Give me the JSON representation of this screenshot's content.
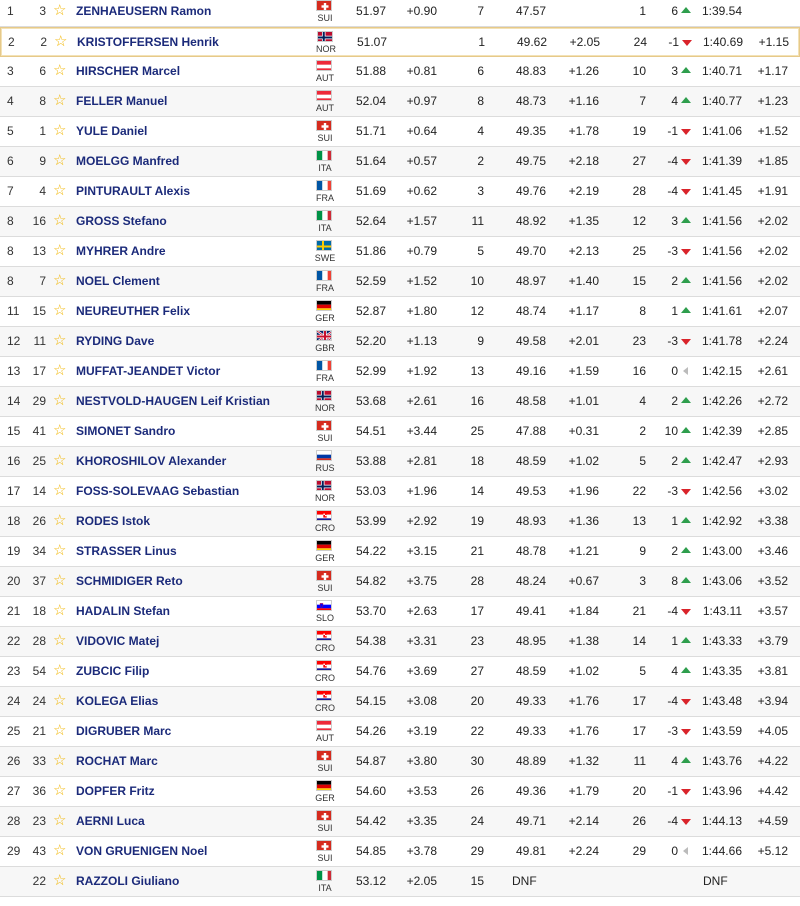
{
  "colors": {
    "name": "#1b2a7a",
    "star": "#f2b705",
    "up": "#2e9e4d",
    "down": "#d9232a",
    "highlight_border": "#e6c98a"
  },
  "icons": {
    "favorite": "star-icon",
    "up": "arrow-up-icon",
    "down": "arrow-down-icon",
    "same": "arrow-left-icon"
  },
  "rows": [
    {
      "rank": "1",
      "bib": "3",
      "name": "ZENHAEUSERN Ramon",
      "nat": "SUI",
      "r1_time": "51.97",
      "r1_diff": "+0.90",
      "r1_rank": "7",
      "r2_time": "47.57",
      "r2_diff": "",
      "r2_rank": "1",
      "change": "6",
      "dir": "up",
      "total": "1:39.54",
      "total_diff": ""
    },
    {
      "rank": "2",
      "bib": "2",
      "name": "KRISTOFFERSEN Henrik",
      "nat": "NOR",
      "r1_time": "51.07",
      "r1_diff": "",
      "r1_rank": "1",
      "r2_time": "49.62",
      "r2_diff": "+2.05",
      "r2_rank": "24",
      "change": "-1",
      "dir": "down",
      "total": "1:40.69",
      "total_diff": "+1.15",
      "highlight": true
    },
    {
      "rank": "3",
      "bib": "6",
      "name": "HIRSCHER Marcel",
      "nat": "AUT",
      "r1_time": "51.88",
      "r1_diff": "+0.81",
      "r1_rank": "6",
      "r2_time": "48.83",
      "r2_diff": "+1.26",
      "r2_rank": "10",
      "change": "3",
      "dir": "up",
      "total": "1:40.71",
      "total_diff": "+1.17"
    },
    {
      "rank": "4",
      "bib": "8",
      "name": "FELLER Manuel",
      "nat": "AUT",
      "r1_time": "52.04",
      "r1_diff": "+0.97",
      "r1_rank": "8",
      "r2_time": "48.73",
      "r2_diff": "+1.16",
      "r2_rank": "7",
      "change": "4",
      "dir": "up",
      "total": "1:40.77",
      "total_diff": "+1.23"
    },
    {
      "rank": "5",
      "bib": "1",
      "name": "YULE Daniel",
      "nat": "SUI",
      "r1_time": "51.71",
      "r1_diff": "+0.64",
      "r1_rank": "4",
      "r2_time": "49.35",
      "r2_diff": "+1.78",
      "r2_rank": "19",
      "change": "-1",
      "dir": "down",
      "total": "1:41.06",
      "total_diff": "+1.52"
    },
    {
      "rank": "6",
      "bib": "9",
      "name": "MOELGG Manfred",
      "nat": "ITA",
      "r1_time": "51.64",
      "r1_diff": "+0.57",
      "r1_rank": "2",
      "r2_time": "49.75",
      "r2_diff": "+2.18",
      "r2_rank": "27",
      "change": "-4",
      "dir": "down",
      "total": "1:41.39",
      "total_diff": "+1.85"
    },
    {
      "rank": "7",
      "bib": "4",
      "name": "PINTURAULT Alexis",
      "nat": "FRA",
      "r1_time": "51.69",
      "r1_diff": "+0.62",
      "r1_rank": "3",
      "r2_time": "49.76",
      "r2_diff": "+2.19",
      "r2_rank": "28",
      "change": "-4",
      "dir": "down",
      "total": "1:41.45",
      "total_diff": "+1.91"
    },
    {
      "rank": "8",
      "bib": "16",
      "name": "GROSS Stefano",
      "nat": "ITA",
      "r1_time": "52.64",
      "r1_diff": "+1.57",
      "r1_rank": "11",
      "r2_time": "48.92",
      "r2_diff": "+1.35",
      "r2_rank": "12",
      "change": "3",
      "dir": "up",
      "total": "1:41.56",
      "total_diff": "+2.02"
    },
    {
      "rank": "8",
      "bib": "13",
      "name": "MYHRER Andre",
      "nat": "SWE",
      "r1_time": "51.86",
      "r1_diff": "+0.79",
      "r1_rank": "5",
      "r2_time": "49.70",
      "r2_diff": "+2.13",
      "r2_rank": "25",
      "change": "-3",
      "dir": "down",
      "total": "1:41.56",
      "total_diff": "+2.02"
    },
    {
      "rank": "8",
      "bib": "7",
      "name": "NOEL Clement",
      "nat": "FRA",
      "r1_time": "52.59",
      "r1_diff": "+1.52",
      "r1_rank": "10",
      "r2_time": "48.97",
      "r2_diff": "+1.40",
      "r2_rank": "15",
      "change": "2",
      "dir": "up",
      "total": "1:41.56",
      "total_diff": "+2.02"
    },
    {
      "rank": "11",
      "bib": "15",
      "name": "NEUREUTHER Felix",
      "nat": "GER",
      "r1_time": "52.87",
      "r1_diff": "+1.80",
      "r1_rank": "12",
      "r2_time": "48.74",
      "r2_diff": "+1.17",
      "r2_rank": "8",
      "change": "1",
      "dir": "up",
      "total": "1:41.61",
      "total_diff": "+2.07"
    },
    {
      "rank": "12",
      "bib": "11",
      "name": "RYDING Dave",
      "nat": "GBR",
      "r1_time": "52.20",
      "r1_diff": "+1.13",
      "r1_rank": "9",
      "r2_time": "49.58",
      "r2_diff": "+2.01",
      "r2_rank": "23",
      "change": "-3",
      "dir": "down",
      "total": "1:41.78",
      "total_diff": "+2.24"
    },
    {
      "rank": "13",
      "bib": "17",
      "name": "MUFFAT-JEANDET Victor",
      "nat": "FRA",
      "r1_time": "52.99",
      "r1_diff": "+1.92",
      "r1_rank": "13",
      "r2_time": "49.16",
      "r2_diff": "+1.59",
      "r2_rank": "16",
      "change": "0",
      "dir": "same",
      "total": "1:42.15",
      "total_diff": "+2.61"
    },
    {
      "rank": "14",
      "bib": "29",
      "name": "NESTVOLD-HAUGEN Leif Kristian",
      "nat": "NOR",
      "r1_time": "53.68",
      "r1_diff": "+2.61",
      "r1_rank": "16",
      "r2_time": "48.58",
      "r2_diff": "+1.01",
      "r2_rank": "4",
      "change": "2",
      "dir": "up",
      "total": "1:42.26",
      "total_diff": "+2.72"
    },
    {
      "rank": "15",
      "bib": "41",
      "name": "SIMONET Sandro",
      "nat": "SUI",
      "r1_time": "54.51",
      "r1_diff": "+3.44",
      "r1_rank": "25",
      "r2_time": "47.88",
      "r2_diff": "+0.31",
      "r2_rank": "2",
      "change": "10",
      "dir": "up",
      "total": "1:42.39",
      "total_diff": "+2.85"
    },
    {
      "rank": "16",
      "bib": "25",
      "name": "KHOROSHILOV Alexander",
      "nat": "RUS",
      "r1_time": "53.88",
      "r1_diff": "+2.81",
      "r1_rank": "18",
      "r2_time": "48.59",
      "r2_diff": "+1.02",
      "r2_rank": "5",
      "change": "2",
      "dir": "up",
      "total": "1:42.47",
      "total_diff": "+2.93"
    },
    {
      "rank": "17",
      "bib": "14",
      "name": "FOSS-SOLEVAAG Sebastian",
      "nat": "NOR",
      "r1_time": "53.03",
      "r1_diff": "+1.96",
      "r1_rank": "14",
      "r2_time": "49.53",
      "r2_diff": "+1.96",
      "r2_rank": "22",
      "change": "-3",
      "dir": "down",
      "total": "1:42.56",
      "total_diff": "+3.02"
    },
    {
      "rank": "18",
      "bib": "26",
      "name": "RODES Istok",
      "nat": "CRO",
      "r1_time": "53.99",
      "r1_diff": "+2.92",
      "r1_rank": "19",
      "r2_time": "48.93",
      "r2_diff": "+1.36",
      "r2_rank": "13",
      "change": "1",
      "dir": "up",
      "total": "1:42.92",
      "total_diff": "+3.38"
    },
    {
      "rank": "19",
      "bib": "34",
      "name": "STRASSER Linus",
      "nat": "GER",
      "r1_time": "54.22",
      "r1_diff": "+3.15",
      "r1_rank": "21",
      "r2_time": "48.78",
      "r2_diff": "+1.21",
      "r2_rank": "9",
      "change": "2",
      "dir": "up",
      "total": "1:43.00",
      "total_diff": "+3.46"
    },
    {
      "rank": "20",
      "bib": "37",
      "name": "SCHMIDIGER Reto",
      "nat": "SUI",
      "r1_time": "54.82",
      "r1_diff": "+3.75",
      "r1_rank": "28",
      "r2_time": "48.24",
      "r2_diff": "+0.67",
      "r2_rank": "3",
      "change": "8",
      "dir": "up",
      "total": "1:43.06",
      "total_diff": "+3.52"
    },
    {
      "rank": "21",
      "bib": "18",
      "name": "HADALIN Stefan",
      "nat": "SLO",
      "r1_time": "53.70",
      "r1_diff": "+2.63",
      "r1_rank": "17",
      "r2_time": "49.41",
      "r2_diff": "+1.84",
      "r2_rank": "21",
      "change": "-4",
      "dir": "down",
      "total": "1:43.11",
      "total_diff": "+3.57"
    },
    {
      "rank": "22",
      "bib": "28",
      "name": "VIDOVIC Matej",
      "nat": "CRO",
      "r1_time": "54.38",
      "r1_diff": "+3.31",
      "r1_rank": "23",
      "r2_time": "48.95",
      "r2_diff": "+1.38",
      "r2_rank": "14",
      "change": "1",
      "dir": "up",
      "total": "1:43.33",
      "total_diff": "+3.79"
    },
    {
      "rank": "23",
      "bib": "54",
      "name": "ZUBCIC Filip",
      "nat": "CRO",
      "r1_time": "54.76",
      "r1_diff": "+3.69",
      "r1_rank": "27",
      "r2_time": "48.59",
      "r2_diff": "+1.02",
      "r2_rank": "5",
      "change": "4",
      "dir": "up",
      "total": "1:43.35",
      "total_diff": "+3.81"
    },
    {
      "rank": "24",
      "bib": "24",
      "name": "KOLEGA Elias",
      "nat": "CRO",
      "r1_time": "54.15",
      "r1_diff": "+3.08",
      "r1_rank": "20",
      "r2_time": "49.33",
      "r2_diff": "+1.76",
      "r2_rank": "17",
      "change": "-4",
      "dir": "down",
      "total": "1:43.48",
      "total_diff": "+3.94"
    },
    {
      "rank": "25",
      "bib": "21",
      "name": "DIGRUBER Marc",
      "nat": "AUT",
      "r1_time": "54.26",
      "r1_diff": "+3.19",
      "r1_rank": "22",
      "r2_time": "49.33",
      "r2_diff": "+1.76",
      "r2_rank": "17",
      "change": "-3",
      "dir": "down",
      "total": "1:43.59",
      "total_diff": "+4.05"
    },
    {
      "rank": "26",
      "bib": "33",
      "name": "ROCHAT Marc",
      "nat": "SUI",
      "r1_time": "54.87",
      "r1_diff": "+3.80",
      "r1_rank": "30",
      "r2_time": "48.89",
      "r2_diff": "+1.32",
      "r2_rank": "11",
      "change": "4",
      "dir": "up",
      "total": "1:43.76",
      "total_diff": "+4.22"
    },
    {
      "rank": "27",
      "bib": "36",
      "name": "DOPFER Fritz",
      "nat": "GER",
      "r1_time": "54.60",
      "r1_diff": "+3.53",
      "r1_rank": "26",
      "r2_time": "49.36",
      "r2_diff": "+1.79",
      "r2_rank": "20",
      "change": "-1",
      "dir": "down",
      "total": "1:43.96",
      "total_diff": "+4.42"
    },
    {
      "rank": "28",
      "bib": "23",
      "name": "AERNI Luca",
      "nat": "SUI",
      "r1_time": "54.42",
      "r1_diff": "+3.35",
      "r1_rank": "24",
      "r2_time": "49.71",
      "r2_diff": "+2.14",
      "r2_rank": "26",
      "change": "-4",
      "dir": "down",
      "total": "1:44.13",
      "total_diff": "+4.59"
    },
    {
      "rank": "29",
      "bib": "43",
      "name": "VON GRUENIGEN Noel",
      "nat": "SUI",
      "r1_time": "54.85",
      "r1_diff": "+3.78",
      "r1_rank": "29",
      "r2_time": "49.81",
      "r2_diff": "+2.24",
      "r2_rank": "29",
      "change": "0",
      "dir": "same",
      "total": "1:44.66",
      "total_diff": "+5.12"
    },
    {
      "rank": "",
      "bib": "22",
      "name": "RAZZOLI Giuliano",
      "nat": "ITA",
      "r1_time": "53.12",
      "r1_diff": "+2.05",
      "r1_rank": "15",
      "r2_time": "DNF",
      "r2_diff": "",
      "r2_rank": "",
      "change": "",
      "dir": "",
      "total": "DNF",
      "total_diff": "",
      "dnf": true
    }
  ]
}
